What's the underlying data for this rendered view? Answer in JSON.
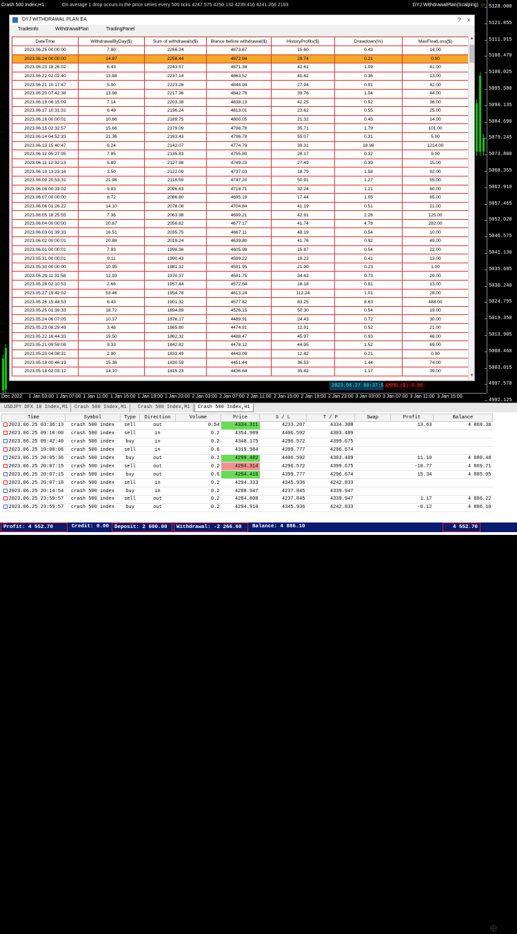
{
  "chart": {
    "symbol_title": "Crash 500 Index,H1:",
    "description": "On average 1 drop occurs in the price series every 500 ticks  4247.575 4250.132 4239.416 4241.266  2193",
    "ea_label": "DYJ WithdrawalPlan(Scalping)",
    "smiley": "☺",
    "price_labels": [
      "5128.000",
      "5121.855",
      "5111.915",
      "5106.470",
      "5100.025",
      "5095.580",
      "5090.135",
      "5084.690",
      "5079.245",
      "5073.800",
      "5068.355",
      "5062.910",
      "5057.465",
      "5052.020",
      "5046.575",
      "5041.130",
      "5035.685",
      "5030.240",
      "5024.795",
      "5019.350",
      "5013.905",
      "5008.460",
      "5003.015",
      "4997.570",
      "4992.125"
    ],
    "time_labels": [
      "Dec 2022",
      "1 Jan 03:00",
      "1 Jan 07:00",
      "1 Jan 11:00",
      "1 Jan 15:00",
      "1 Jan 19:00",
      "1 Jan 23:00",
      "2 Jan 03:00",
      "2 Jan 07:00",
      "2 Jan 11:00",
      "2 Jan 15:00",
      "2 Jan 19:00",
      "2 Jan 23:00",
      "3 Jan 03:00",
      "3 Jan 07:00",
      "3 Jan 11:00",
      "3 Jan 15:00"
    ],
    "time_label": "2023.06.27 00:37:59",
    "ambbl_label": "AMPBL($)-0.06"
  },
  "ea": {
    "title": "DYJ WITHDRAWAL PLAN EA",
    "tabs": [
      "TradeInfo",
      "WithdrawalPlan",
      "TradingPanel"
    ],
    "columns": [
      "DateTime",
      "WithdrawalByDay($)",
      "Sum of withdrawals($)",
      "Blance before withdrawal($)",
      "HistoryProfits($)",
      "Drawdown(%)",
      "MaxFloatLoss($)"
    ],
    "highlight_row": 1,
    "rows": [
      [
        "2023.06.25 00:00:00",
        "7.80",
        "2266.24",
        "4873.67",
        "15.60",
        "0.43",
        "14.00"
      ],
      [
        "2023.06.24 00:00:00",
        "14.87",
        "2258.44",
        "4872.94",
        "29.74",
        "0.21",
        "0.00"
      ],
      [
        "2023.06.23 18:26:02",
        "6.43",
        "2243.57",
        "4871.38",
        "42.61",
        "1.09",
        "41.00"
      ],
      [
        "2023.06.22 02:02:40",
        "13.88",
        "2237.14",
        "4863.52",
        "40.62",
        "0.36",
        "13.00"
      ],
      [
        "2023.06.21 10:17:47",
        "5.90",
        "2223.26",
        "4844.94",
        "27.94",
        "0.91",
        "42.00"
      ],
      [
        "2023.06.20 07:42:38",
        "13.98",
        "2217.36",
        "4842.78",
        "39.76",
        "1.04",
        "44.00"
      ],
      [
        "2023.06.19 06:15:09",
        "7.14",
        "2203.38",
        "4838.13",
        "42.25",
        "0.92",
        "36.00"
      ],
      [
        "2023.06.17 10:31:31",
        "6.49",
        "2196.24",
        "4813.01",
        "23.62",
        "0.55",
        "25.00"
      ],
      [
        "2023.06.16 00:00:01",
        "10.66",
        "2189.75",
        "4800.05",
        "21.32",
        "0.45",
        "14.00"
      ],
      [
        "2023.06.15 02:32:57",
        "15.66",
        "2179.09",
        "4798.78",
        "35.71",
        "1.79",
        "101.00"
      ],
      [
        "2023.06.14 04:52:33",
        "21.36",
        "2163.43",
        "4796.78",
        "55.07",
        "0.31",
        "5.00"
      ],
      [
        "2023.06.13 15:40:47",
        "6.24",
        "2142.07",
        "4774.79",
        "39.31",
        "18.98",
        "1214.00"
      ],
      [
        "2023.06.12 05:27:05",
        "7.85",
        "2135.83",
        "4755.80",
        "28.17",
        "0.32",
        "9.00"
      ],
      [
        "2023.06.11 12:32:13",
        "5.89",
        "2127.98",
        "4749.23",
        "27.49",
        "0.39",
        "15.00"
      ],
      [
        "2023.06.10 13:23:16",
        "3.50",
        "2122.09",
        "4737.03",
        "18.79",
        "1.58",
        "92.00"
      ],
      [
        "2023.06.09 20:53:31",
        "21.96",
        "2118.59",
        "4747.20",
        "50.91",
        "1.27",
        "55.00"
      ],
      [
        "2023.06.08 00:33:02",
        "9.83",
        "2096.63",
        "4718.71",
        "32.24",
        "1.21",
        "60.00"
      ],
      [
        "2023.06.07 00:00:00",
        "8.72",
        "2086.80",
        "4695.19",
        "17.44",
        "1.05",
        "65.00"
      ],
      [
        "2023.06.06 01:26:22",
        "14.10",
        "2078.08",
        "4704.84",
        "41.19",
        "0.51",
        "21.00"
      ],
      [
        "2023.06.05 18:25:55",
        "7.36",
        "2063.98",
        "4699.21",
        "42.91",
        "2.28",
        "125.00"
      ],
      [
        "2023.06.04 00:00:00",
        "20.87",
        "2056.62",
        "4677.17",
        "41.74",
        "4.78",
        "282.00"
      ],
      [
        "2023.06.03 01:39:33",
        "16.51",
        "2035.75",
        "4667.11",
        "48.19",
        "0.54",
        "10.00"
      ],
      [
        "2023.06.02 00:00:01",
        "20.88",
        "2019.24",
        "4639.80",
        "41.76",
        "0.92",
        "49.00"
      ],
      [
        "2023.06.01 00:00:01",
        "7.93",
        "1998.36",
        "4605.98",
        "15.87",
        "0.54",
        "22.00"
      ],
      [
        "2023.05.31 00:00:01",
        "9.11",
        "1990.43",
        "4599.22",
        "18.22",
        "0.41",
        "13.00"
      ],
      [
        "2023.05.30 00:00:00",
        "10.95",
        "1981.32",
        "4591.95",
        "21.90",
        "0.23",
        "1.00"
      ],
      [
        "2023.05.29 11:31:58",
        "12.93",
        "1970.37",
        "4591.75",
        "34.63",
        "0.73",
        "29.00"
      ],
      [
        "2023.05.28 02:10:53",
        "2.66",
        "1957.44",
        "4572.64",
        "18.18",
        "0.81",
        "13.00"
      ],
      [
        "2023.05.27 19:42:02",
        "53.46",
        "1954.78",
        "4613.24",
        "112.24",
        "1.01",
        "28.00"
      ],
      [
        "2023.05.26 15:48:53",
        "6.43",
        "1901.32",
        "4577.82",
        "83.25",
        "8.63",
        "488.00"
      ],
      [
        "2023.05.25 01:39:33",
        "18.72",
        "1894.89",
        "4526.15",
        "50.30",
        "0.54",
        "19.00"
      ],
      [
        "2023.05.24 06:07:05",
        "10.37",
        "1876.17",
        "4489.91",
        "24.43",
        "0.72",
        "30.00"
      ],
      [
        "2023.05.23 08:29:49",
        "3.48",
        "1865.80",
        "4474.91",
        "12.91",
        "0.52",
        "21.00"
      ],
      [
        "2023.05.22 16:44:33",
        "19.50",
        "1862.32",
        "4488.47",
        "45.97",
        "0.93",
        "48.00"
      ],
      [
        "2023.05.21 09:59:08",
        "9.33",
        "1842.82",
        "4478.12",
        "44.95",
        "1.52",
        "69.00"
      ],
      [
        "2023.05.20 04:08:31",
        "2.90",
        "1833.49",
        "4443.09",
        "12.82",
        "0.21",
        "0.00"
      ],
      [
        "2023.05.19 00:46:19",
        "15.36",
        "1830.59",
        "4451.44",
        "36.53",
        "1.44",
        "74.00"
      ],
      [
        "2023.05.18 02:03:12",
        "14.10",
        "1815.23",
        "4436.64",
        "35.82",
        "1.17",
        "39.00"
      ]
    ]
  },
  "symbol_tabs": [
    "USDJPY DFX 10 Index,M1",
    "Crash 500 Index,M1",
    "Crash 500 Index,M1",
    "Crash 500 Index,H1"
  ],
  "terminal": {
    "columns": [
      "Time",
      "Symbol",
      "Type",
      "Direction",
      "Volume",
      "Price",
      "S / L",
      "T / P",
      "Swap",
      "Profit",
      "Balance"
    ],
    "rows": [
      {
        "time": "2023.06.25 03:36:13",
        "symbol": "crash 500 index",
        "type": "sell",
        "dir": "out",
        "vol": "0.54",
        "price": "4334.311",
        "sl": "4233.207",
        "tp": "4334.308",
        "swap": "",
        "profit": "13.63",
        "balance": "4 869.38",
        "hl": "g",
        "ico": "red"
      },
      {
        "time": "2023.06.25 09:10:00",
        "symbol": "crash 500 index",
        "type": "sell",
        "dir": "in",
        "vol": "0.2",
        "price": "4354.989",
        "sl": "4406.592",
        "tp": "4303.489",
        "swap": "",
        "profit": "",
        "balance": "",
        "hl": "",
        "ico": "red"
      },
      {
        "time": "2023.06.25 09:42:40",
        "symbol": "crash 500 index",
        "type": "buy",
        "dir": "in",
        "vol": "0.2",
        "price": "4348.175",
        "sl": "4296.572",
        "tp": "4399.675",
        "swap": "",
        "profit": "",
        "balance": "",
        "hl": "",
        "ico": "blue"
      },
      {
        "time": "2023.06.25 10:08:06",
        "symbol": "crash 500 index",
        "type": "sell",
        "dir": "in",
        "vol": "0.6",
        "price": "4319.984",
        "sl": "4399.777",
        "tp": "4296.674",
        "swap": "",
        "profit": "",
        "balance": "",
        "hl": "",
        "ico": "red"
      },
      {
        "time": "2023.06.25 20:05:36",
        "symbol": "crash 500 index",
        "type": "buy",
        "dir": "out",
        "vol": "0.2",
        "price": "4299.482",
        "sl": "4406.592",
        "tp": "4303.489",
        "swap": "",
        "profit": "11.10",
        "balance": "4 880.48",
        "hl": "g",
        "ico": "blue"
      },
      {
        "time": "2023.06.25 20:07:15",
        "symbol": "crash 500 index",
        "type": "sell",
        "dir": "out",
        "vol": "0.2",
        "price": "4294.314",
        "sl": "4296.572",
        "tp": "4399.675",
        "swap": "",
        "profit": "-10.77",
        "balance": "4 869.71",
        "hl": "r",
        "ico": "red"
      },
      {
        "time": "2023.06.25 20:07:15",
        "symbol": "crash 500 index",
        "type": "buy",
        "dir": "out",
        "vol": "0.6",
        "price": "4294.416",
        "sl": "4399.777",
        "tp": "4296.674",
        "swap": "",
        "profit": "15.34",
        "balance": "4 885.05",
        "hl": "g",
        "ico": "blue"
      },
      {
        "time": "2023.06.25 20:07:18",
        "symbol": "crash 500 index",
        "type": "sell",
        "dir": "in",
        "vol": "0.2",
        "price": "4294.333",
        "sl": "4345.936",
        "tp": "4242.833",
        "swap": "",
        "profit": "",
        "balance": "",
        "hl": "",
        "ico": "red"
      },
      {
        "time": "2023.06.25 20:14:54",
        "symbol": "crash 500 index",
        "type": "buy",
        "dir": "in",
        "vol": "0.2",
        "price": "4288.947",
        "sl": "4237.845",
        "tp": "4339.947",
        "swap": "",
        "profit": "",
        "balance": "",
        "hl": "",
        "ico": "blue"
      },
      {
        "time": "2023.06.25 23:59:57",
        "symbol": "crash 500 index",
        "type": "sell",
        "dir": "out",
        "vol": "0.2",
        "price": "4284.808",
        "sl": "4237.845",
        "tp": "4339.947",
        "swap": "",
        "profit": "1.17",
        "balance": "4 886.22",
        "hl": "",
        "ico": "red"
      },
      {
        "time": "2023.06.25 23:59:57",
        "symbol": "crash 500 index",
        "type": "buy",
        "dir": "out",
        "vol": "0.2",
        "price": "4294.910",
        "sl": "4345.936",
        "tp": "4242.833",
        "swap": "",
        "profit": "-0.12",
        "balance": "4 886.10",
        "hl": "",
        "ico": "blue"
      }
    ]
  },
  "summary": {
    "profit": "Profit: 4 552.70",
    "credit": "Credit: 0.00",
    "deposit": "Deposit: 2 600.00",
    "withdrawal": "Withdrawal: -2 266.60",
    "balance": "Balance: 4 886.10",
    "total": "4 552.70"
  },
  "colors": {
    "table_border": "#e03030",
    "highlight": "#f4a825",
    "profit_green": "#66dd55",
    "loss_red": "#f29090",
    "summary_bg": "#0a1a6e"
  }
}
